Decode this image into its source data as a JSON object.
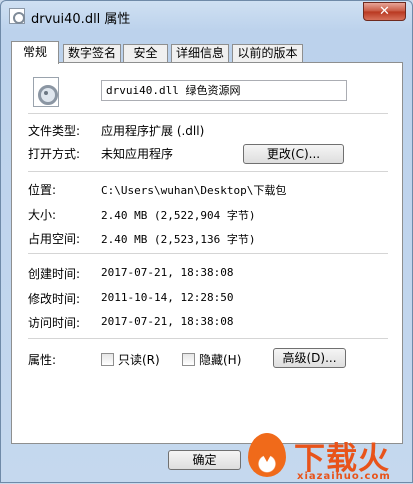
{
  "window": {
    "title": "drvui40.dll 属性",
    "close_label": "✕"
  },
  "tabs": [
    {
      "label": "常规",
      "active": true
    },
    {
      "label": "数字签名",
      "active": false
    },
    {
      "label": "安全",
      "active": false
    },
    {
      "label": "详细信息",
      "active": false
    },
    {
      "label": "以前的版本",
      "active": false
    }
  ],
  "general": {
    "file_icon": "dll-gear-icon",
    "filename": "drvui40.dll 绿色资源网",
    "type_label": "文件类型:",
    "type_value": "应用程序扩展 (.dll)",
    "opens_label": "打开方式:",
    "opens_value": "未知应用程序",
    "change_button": "更改(C)...",
    "location_label": "位置:",
    "location_value": "C:\\Users\\wuhan\\Desktop\\下载包",
    "size_label": "大小:",
    "size_value": "2.40 MB (2,522,904 字节)",
    "size_on_disk_label": "占用空间:",
    "size_on_disk_value": "2.40 MB (2,523,136 字节)",
    "created_label": "创建时间:",
    "created_value": "2017-07-21, 18:38:08",
    "modified_label": "修改时间:",
    "modified_value": "2011-10-14, 12:28:50",
    "accessed_label": "访问时间:",
    "accessed_value": "2017-07-21, 18:38:08",
    "attributes_label": "属性:",
    "readonly_label": "只读(R)",
    "readonly_checked": false,
    "hidden_label": "隐藏(H)",
    "hidden_checked": false,
    "advanced_button": "高级(D)..."
  },
  "footer": {
    "ok_button": "确定"
  },
  "watermark": {
    "brand": "下载火",
    "url": "xiazaihuo.com"
  },
  "colors": {
    "titlebar": "#cfe0f2",
    "close": "#c7563f",
    "watermark": "#e8531a"
  }
}
